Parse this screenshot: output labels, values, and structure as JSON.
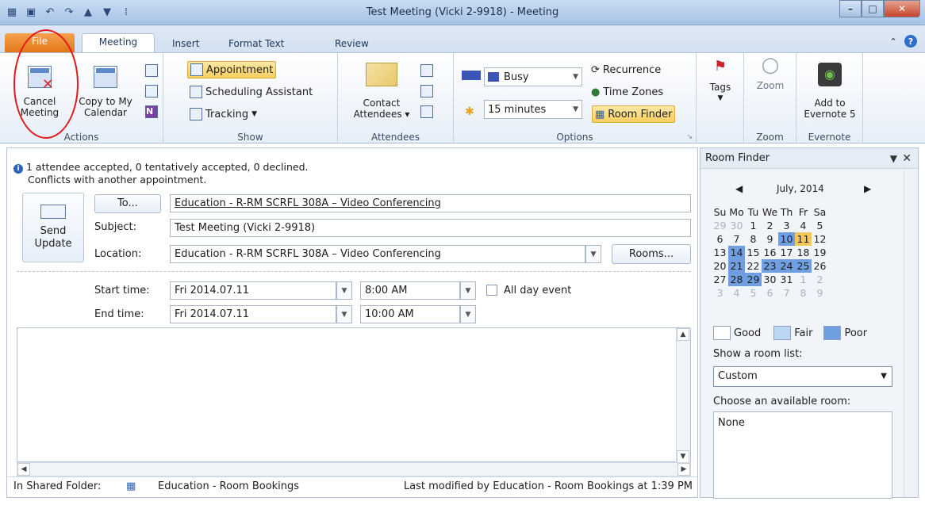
{
  "window": {
    "title": "Test Meeting (Vicki 2-9918)  -  Meeting"
  },
  "tabs": [
    "File",
    "Meeting",
    "Insert",
    "Format Text",
    "Review"
  ],
  "ribbon": {
    "actions": {
      "label": "Actions",
      "cancel_line1": "Cancel",
      "cancel_line2": "Meeting",
      "copy_line1": "Copy to My",
      "copy_line2": "Calendar"
    },
    "show": {
      "label": "Show",
      "appointment": "Appointment",
      "scheduling": "Scheduling Assistant",
      "tracking": "Tracking"
    },
    "attendees": {
      "label": "Attendees",
      "contact_line1": "Contact",
      "contact_line2": "Attendees"
    },
    "options": {
      "label": "Options",
      "busy": "Busy",
      "reminder": "15 minutes",
      "recurrence": "Recurrence",
      "time_zones": "Time Zones",
      "room_finder": "Room Finder"
    },
    "tags": {
      "label": "Tags"
    },
    "zoom": {
      "label": "Zoom",
      "button": "Zoom"
    },
    "evernote": {
      "label": "Evernote",
      "line1": "Add to",
      "line2": "Evernote 5"
    }
  },
  "form": {
    "info_line1": "1 attendee accepted, 0 tentatively accepted, 0 declined.",
    "info_line2": "Conflicts with another appointment.",
    "send_line1": "Send",
    "send_line2": "Update",
    "to_button": "To...",
    "to_value": "Education - R-RM SCRFL 308A – Video Conferencing",
    "subject_label": "Subject:",
    "subject_value": "Test Meeting (Vicki 2-9918)",
    "location_label": "Location:",
    "location_value": "Education - R-RM SCRFL 308A – Video Conferencing",
    "rooms_button": "Rooms...",
    "start_label": "Start time:",
    "start_date": "Fri 2014.07.11",
    "start_time": "8:00 AM",
    "all_day": "All day event",
    "end_label": "End time:",
    "end_date": "Fri 2014.07.11",
    "end_time": "10:00 AM",
    "shared_folder_label": "In Shared Folder:",
    "shared_folder_value": "Education - Room Bookings",
    "last_modified": "Last modified by Education - Room Bookings at 1:39 PM"
  },
  "room_finder": {
    "title": "Room Finder",
    "month": "July, 2014",
    "weekdays": [
      "Su",
      "Mo",
      "Tu",
      "We",
      "Th",
      "Fr",
      "Sa"
    ],
    "weeks": [
      [
        "29",
        "30",
        "1",
        "2",
        "3",
        "4",
        "5"
      ],
      [
        "6",
        "7",
        "8",
        "9",
        "10",
        "11",
        "12"
      ],
      [
        "13",
        "14",
        "15",
        "16",
        "17",
        "18",
        "19"
      ],
      [
        "20",
        "21",
        "22",
        "23",
        "24",
        "25",
        "26"
      ],
      [
        "27",
        "28",
        "29",
        "30",
        "31",
        "1",
        "2"
      ],
      [
        "3",
        "4",
        "5",
        "6",
        "7",
        "8",
        "9"
      ]
    ],
    "legend_good": "Good",
    "legend_fair": "Fair",
    "legend_poor": "Poor",
    "room_list_label": "Show a room list:",
    "room_list_value": "Custom",
    "available_label": "Choose an available room:",
    "available_value": "None"
  },
  "colors": {
    "poor": "#6f9fe0",
    "fair": "#bcd6f3",
    "selected": "#f4c85b",
    "annotation": "#e01a1a"
  }
}
